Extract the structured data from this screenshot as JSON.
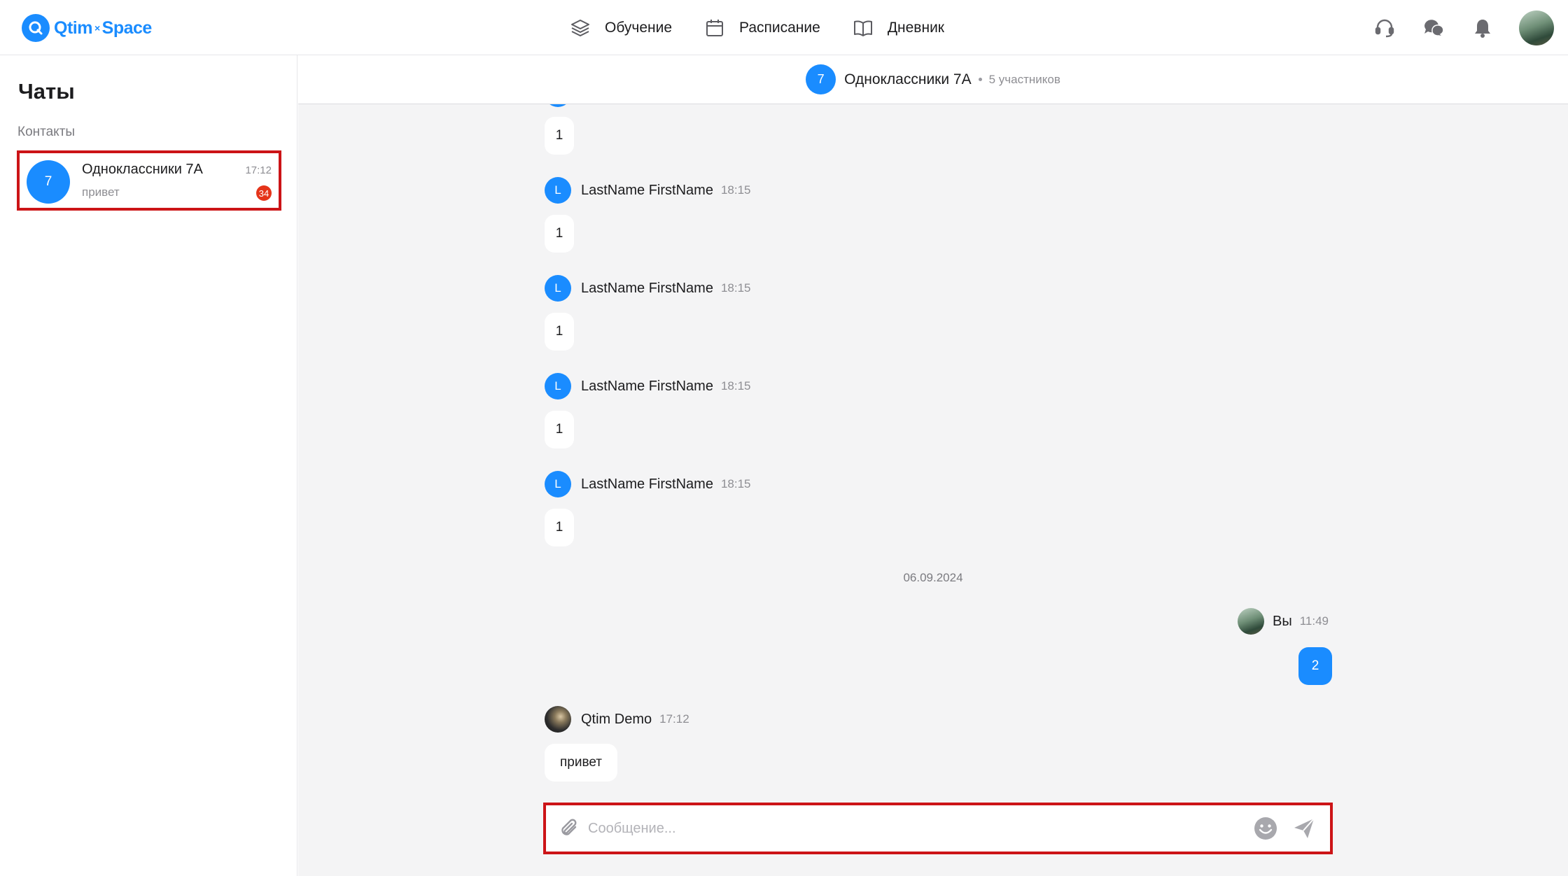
{
  "header": {
    "logo_left": "Qtim",
    "logo_x": "×",
    "logo_right": "Space",
    "nav": [
      {
        "label": "Обучение",
        "icon": "layers-icon"
      },
      {
        "label": "Расписание",
        "icon": "calendar-icon"
      },
      {
        "label": "Дневник",
        "icon": "book-icon"
      }
    ],
    "icons": [
      "headset-icon",
      "chat-bubbles-icon",
      "bell-icon",
      "user-avatar"
    ]
  },
  "sidebar": {
    "title": "Чаты",
    "section": "Контакты",
    "chats": [
      {
        "avatar": "7",
        "name": "Одноклассники 7А",
        "time": "17:12",
        "preview": "привет",
        "unread": "34"
      }
    ]
  },
  "chat": {
    "avatar": "7",
    "name": "Одноклассники 7А",
    "members": "5 участников",
    "messages": [
      {
        "text": "1"
      },
      {
        "initial": "L",
        "author": "LastName FirstName",
        "time": "18:15",
        "text": "1"
      },
      {
        "initial": "L",
        "author": "LastName FirstName",
        "time": "18:15",
        "text": "1"
      },
      {
        "initial": "L",
        "author": "LastName FirstName",
        "time": "18:15",
        "text": "1"
      },
      {
        "initial": "L",
        "author": "LastName FirstName",
        "time": "18:15",
        "text": "1"
      }
    ],
    "date_separator": "06.09.2024",
    "my_message": {
      "author": "Вы",
      "time": "11:49",
      "text": "2"
    },
    "last_message": {
      "author": "Qtim Demo",
      "time": "17:12",
      "text": "привет"
    },
    "input_placeholder": "Сообщение..."
  },
  "colors": {
    "accent": "#1a8cff",
    "badge": "#e5341a",
    "highlight": "#cc1417"
  }
}
